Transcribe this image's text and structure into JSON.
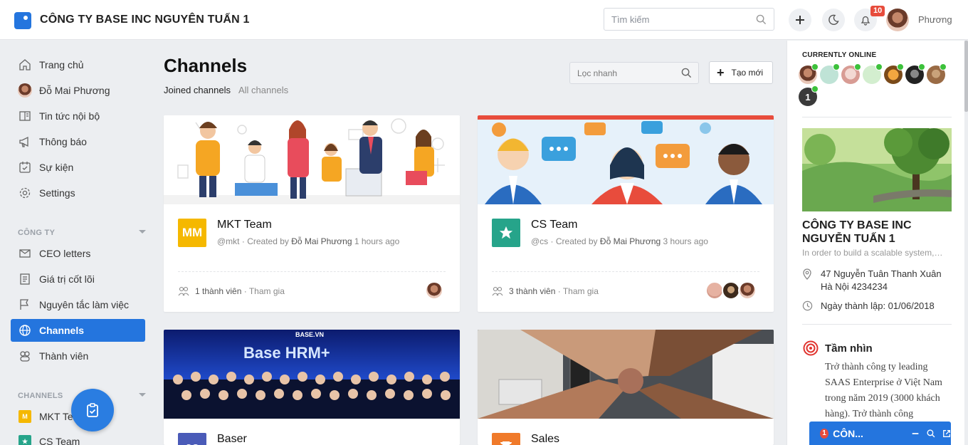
{
  "header": {
    "company": "CÔNG TY BASE INC NGUYÊN TUẤN 1",
    "search_placeholder": "Tìm kiếm",
    "notif_count": "10",
    "user_name": "Phương"
  },
  "sidebar": {
    "items": [
      {
        "label": "Trang chủ",
        "icon": "home-icon"
      },
      {
        "label": "Đỗ Mai Phương",
        "icon": "avatar"
      },
      {
        "label": "Tin tức nội bộ",
        "icon": "newspaper-icon"
      },
      {
        "label": "Thông báo",
        "icon": "megaphone-icon"
      },
      {
        "label": "Sự kiện",
        "icon": "calendar-check-icon"
      },
      {
        "label": "Settings",
        "icon": "gear-icon"
      }
    ],
    "company_section": "CÔNG TY",
    "company_items": [
      {
        "label": "CEO letters",
        "icon": "mail-icon"
      },
      {
        "label": "Giá trị cốt lõi",
        "icon": "document-icon"
      },
      {
        "label": "Nguyên tắc làm việc",
        "icon": "flag-icon"
      },
      {
        "label": "Channels",
        "icon": "globe-icon"
      },
      {
        "label": "Thành viên",
        "icon": "users-icon"
      }
    ],
    "channels_section": "CHANNELS",
    "channel_items": [
      {
        "label": "MKT Team",
        "badge": "M",
        "color": "#f5b800"
      },
      {
        "label": "CS Team",
        "badge": "★",
        "color": "#26a48a"
      }
    ]
  },
  "main": {
    "title": "Channels",
    "tabs": [
      "Joined channels",
      "All channels"
    ],
    "quick_placeholder": "Lọc nhanh",
    "new_button": "Tạo mới",
    "cards": [
      {
        "name": "MKT Team",
        "handle": "@mkt",
        "created_by_label": "· Created by",
        "creator": "Đỗ Mai Phương",
        "time": "1 hours ago",
        "members": "1 thành viên",
        "join": "· Tham gia",
        "icon_text": "MM",
        "icon_color": "#f5b800"
      },
      {
        "name": "CS Team",
        "handle": "@cs",
        "created_by_label": "· Created by",
        "creator": "Đỗ Mai Phương",
        "time": "3 hours ago",
        "members": "3 thành viên",
        "join": "· Tham gia",
        "icon_text": "★",
        "icon_color": "#26a48a"
      },
      {
        "name": "Baser",
        "icon_text": "co",
        "icon_color": "#4a5bb8",
        "banner_text": "Base HRM+",
        "banner_sub": "BASE.VN"
      },
      {
        "name": "Sales",
        "icon_text": "🏆",
        "icon_color": "#f07a2a"
      }
    ]
  },
  "right": {
    "online_title": "CURRENTLY ONLINE",
    "online_extra": "1",
    "company_name": "CÔNG TY BASE INC NGUYỄN TUẤN 1",
    "company_desc": "In order to build a scalable system, th...",
    "address": "47 Nguyễn Tuân Thanh Xuân Hà Nội 4234234",
    "founded": "Ngày thành lập: 01/06/2018",
    "vision_title": "Tầm nhìn",
    "vision_text": "Trở thành công ty leading SAAS Enterprise ở Việt Nam trong năm 2019 (3000 khách hàng). Trở thành công",
    "chat_count": "1",
    "chat_label": "CÔN..."
  }
}
